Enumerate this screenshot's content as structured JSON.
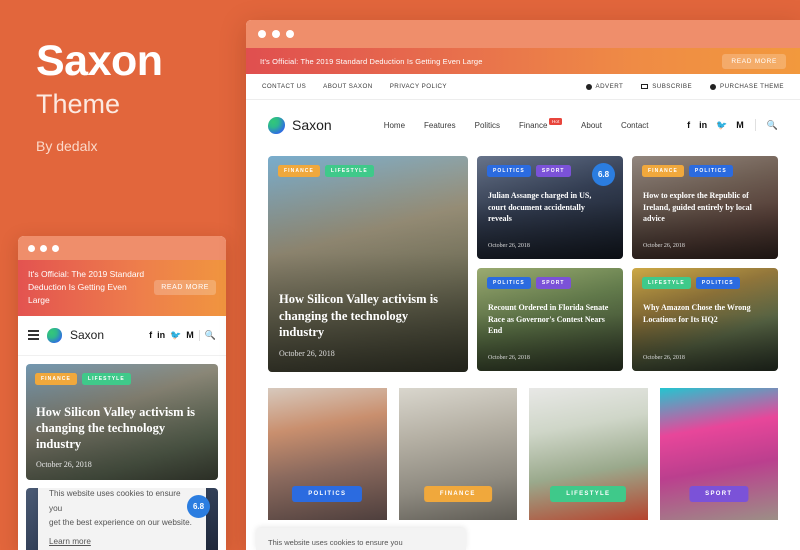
{
  "promo": {
    "title": "Saxon",
    "subtitle": "Theme",
    "author": "By dedalx"
  },
  "colors": {
    "background": "#e2663c",
    "chrome": "#ef8e6b",
    "announce_start": "#e04f4f",
    "announce_end": "#f2993d",
    "cat_finance": "#f0a83c",
    "cat_lifestyle": "#3fc98a",
    "cat_politics": "#2b6be0",
    "cat_sport": "#7b52d8",
    "hot_badge": "#e8453c",
    "rating_badge": "#2b7de0"
  },
  "announcement": {
    "text": "It's Official: The 2019 Standard Deduction Is Getting Even Large",
    "button": "READ MORE"
  },
  "topbar": {
    "links": [
      {
        "label": "CONTACT US"
      },
      {
        "label": "ABOUT SAXON"
      },
      {
        "label": "PRIVACY POLICY"
      }
    ],
    "right": [
      {
        "label": "ADVERT",
        "icon": "advert-icon"
      },
      {
        "label": "SUBSCRIBE",
        "icon": "envelope-icon"
      },
      {
        "label": "PURCHASE THEME",
        "icon": "cart-icon"
      }
    ]
  },
  "nav": {
    "logo_text": "Saxon",
    "logo_icon": "saxon-blob-logo",
    "menu": [
      {
        "label": "Home",
        "badge": ""
      },
      {
        "label": "Features",
        "badge": ""
      },
      {
        "label": "Politics",
        "badge": ""
      },
      {
        "label": "Finance",
        "badge": "Hot"
      },
      {
        "label": "About",
        "badge": ""
      },
      {
        "label": "Contact",
        "badge": ""
      }
    ],
    "social": [
      {
        "icon": "facebook-icon",
        "glyph": "f"
      },
      {
        "icon": "linkedin-icon",
        "glyph": "in"
      },
      {
        "icon": "twitter-icon",
        "glyph": "🐦"
      },
      {
        "icon": "medium-icon",
        "glyph": "M"
      }
    ],
    "search_icon": "search-icon"
  },
  "featured": {
    "main": {
      "categories": [
        "FINANCE",
        "LIFESTYLE"
      ],
      "title": "How Silicon Valley activism is changing the technology industry",
      "date": "October 26, 2018"
    },
    "cards": [
      {
        "categories": [
          "POLITICS",
          "SPORT"
        ],
        "title": "Julian Assange charged in US, court document accidentally reveals",
        "date": "October 26, 2018",
        "rating": "6.8"
      },
      {
        "categories": [
          "FINANCE",
          "POLITICS"
        ],
        "title": "How to explore the Republic of Ireland, guided entirely by local advice",
        "date": "October 26, 2018",
        "rating": ""
      },
      {
        "categories": [
          "POLITICS",
          "SPORT"
        ],
        "title": "Recount Ordered in Florida Senate Race as Governor's Contest Nears End",
        "date": "October 26, 2018",
        "rating": ""
      },
      {
        "categories": [
          "LIFESTYLE",
          "POLITICS"
        ],
        "title": "Why Amazon Chose the Wrong Locations for Its HQ2",
        "date": "October 26, 2018",
        "rating": ""
      }
    ]
  },
  "tiles": [
    {
      "category": "POLITICS"
    },
    {
      "category": "FINANCE"
    },
    {
      "category": "LIFESTYLE"
    },
    {
      "category": "SPORT"
    }
  ],
  "cookie": {
    "line1": "This website uses cookies to ensure you",
    "line2": "get the best experience on our website.",
    "link": "Learn more"
  },
  "mobile": {
    "logo_text": "Saxon",
    "menu_icon": "hamburger-icon",
    "search_icon": "search-icon"
  }
}
